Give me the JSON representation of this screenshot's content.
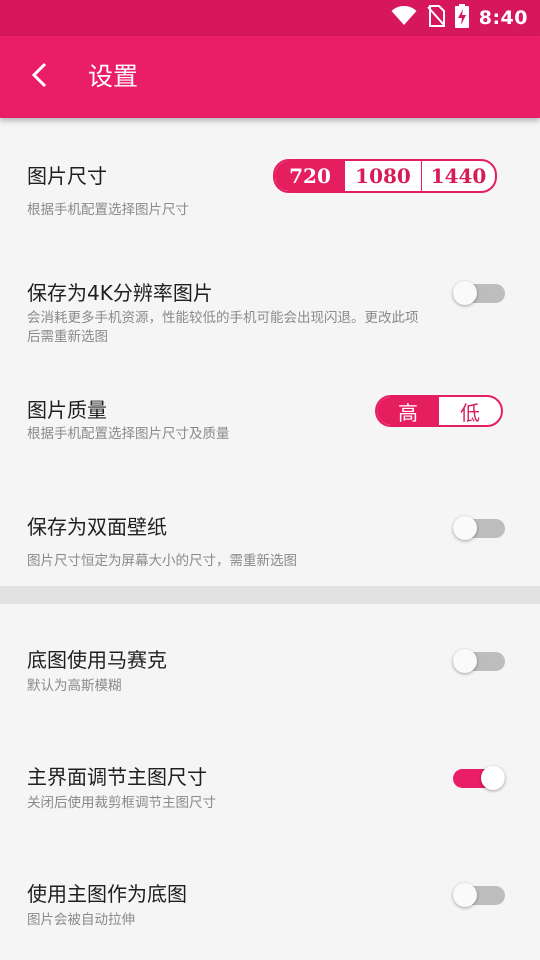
{
  "status": {
    "time": "8:40"
  },
  "appbar": {
    "title": "设置"
  },
  "settings": {
    "image_size": {
      "title": "图片尺寸",
      "subtitle": "根据手机配置选择图片尺寸",
      "options": [
        "720",
        "1080",
        "1440"
      ],
      "selected": "720"
    },
    "save_4k": {
      "title": "保存为4K分辨率图片",
      "subtitle": "会消耗更多手机资源，性能较低的手机可能会出现闪退。更改此项后需重新选图",
      "enabled": false
    },
    "quality": {
      "title": "图片质量",
      "subtitle": "根据手机配置选择图片尺寸及质量",
      "options": [
        "高",
        "低"
      ],
      "selected": "高"
    },
    "dual_wallpaper": {
      "title": "保存为双面壁纸",
      "subtitle": "图片尺寸恒定为屏幕大小的尺寸，需重新选图",
      "enabled": false
    },
    "mosaic_bg": {
      "title": "底图使用马赛克",
      "subtitle": "默认为高斯模糊",
      "enabled": false
    },
    "main_resize": {
      "title": "主界面调节主图尺寸",
      "subtitle": "关闭后使用裁剪框调节主图尺寸",
      "enabled": true
    },
    "main_as_bg": {
      "title": "使用主图作为底图",
      "subtitle": "图片会被自动拉伸",
      "enabled": false
    }
  },
  "colors": {
    "accent": "#ea1d67",
    "status_bar": "#d6175c"
  },
  "icons": [
    "wifi-icon",
    "no-sim-icon",
    "battery-charging-icon",
    "back-arrow-icon"
  ]
}
